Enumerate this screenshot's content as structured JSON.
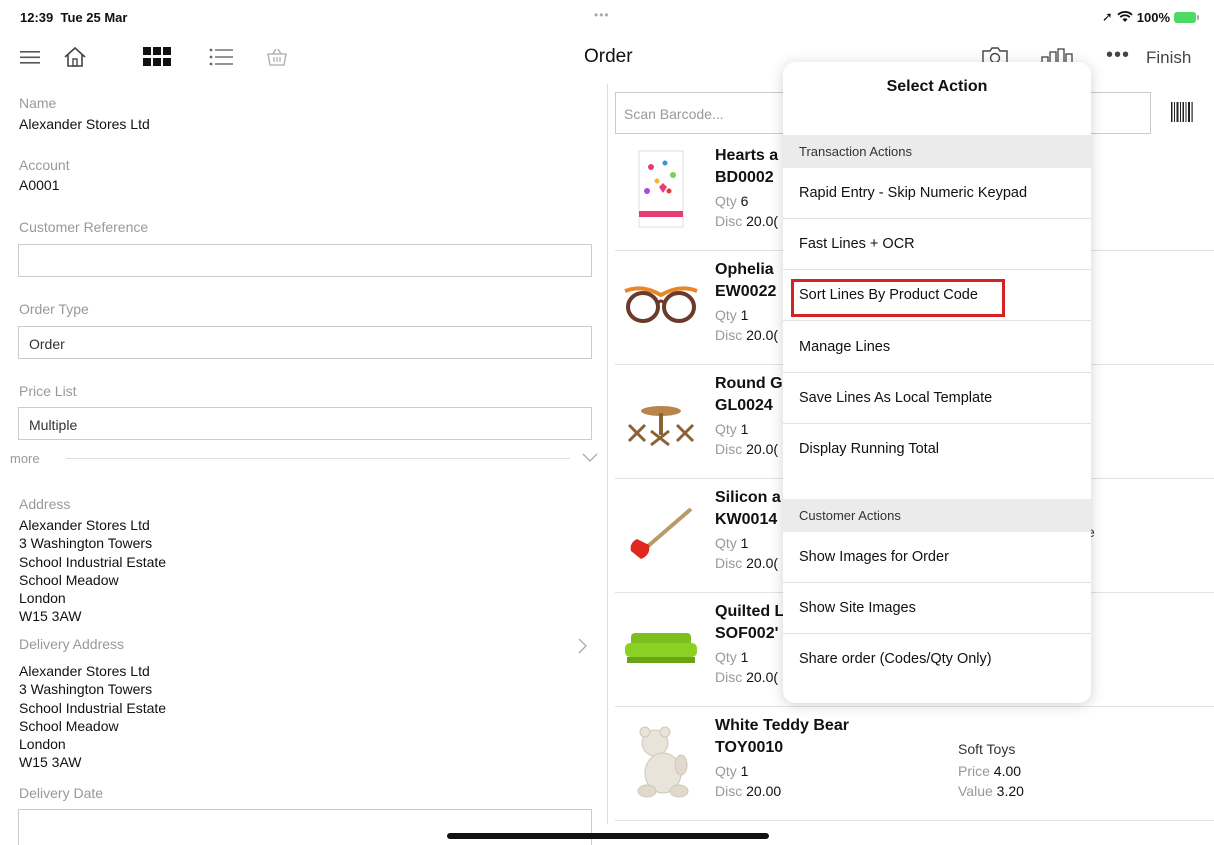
{
  "status_bar": {
    "time": "12:39",
    "date": "Tue 25 Mar",
    "battery": "100%"
  },
  "nav": {
    "title": "Order",
    "more_label": "•••",
    "finish_label": "Finish"
  },
  "customer": {
    "name_label": "Name",
    "name_value": "Alexander Stores Ltd",
    "account_label": "Account",
    "account_value": "A0001",
    "reference_label": "Customer Reference",
    "reference_value": "",
    "order_type_label": "Order Type",
    "order_type_value": "Order",
    "price_list_label": "Price List",
    "price_list_value": "Multiple",
    "more_label": "more",
    "address_label": "Address",
    "address_lines": [
      "Alexander Stores Ltd",
      "3 Washington Towers",
      "School Industrial Estate",
      "School Meadow",
      "London",
      "W15 3AW"
    ],
    "delivery_address_label": "Delivery Address",
    "delivery_address_lines": [
      "Alexander Stores Ltd",
      "3 Washington Towers",
      "School Industrial Estate",
      "School Meadow",
      "London",
      "W15 3AW"
    ],
    "delivery_date_label": "Delivery Date"
  },
  "scan": {
    "placeholder": "Scan Barcode..."
  },
  "products": [
    {
      "name": "Hearts a",
      "code": "BD0002",
      "qty_label": "Qty",
      "qty": "6",
      "disc_label": "Disc",
      "disc": "20.0("
    },
    {
      "name": "Ophelia",
      "code": "EW0022",
      "qty_label": "Qty",
      "qty": "1",
      "disc_label": "Disc",
      "disc": "20.0("
    },
    {
      "name": "Round G",
      "code": "GL0024",
      "qty_label": "Qty",
      "qty": "1",
      "disc_label": "Disc",
      "disc": "20.0("
    },
    {
      "name": "Silicon a",
      "code": "KW0014",
      "qty_label": "Qty",
      "qty": "1",
      "disc_label": "Disc",
      "disc": "20.0("
    },
    {
      "name": "Quilted L",
      "code": "SOF002'",
      "qty_label": "Qty",
      "qty": "1",
      "disc_label": "Disc",
      "disc": "20.0("
    },
    {
      "name": "White Teddy Bear",
      "code": "TOY0010",
      "qty_label": "Qty",
      "qty": "1",
      "disc_label": "Disc",
      "disc": "20.00",
      "category": "Soft Toys",
      "price_label": "Price",
      "price": "4.00",
      "value_label": "Value",
      "value": "3.20"
    }
  ],
  "stray_text": "e",
  "popover": {
    "title": "Select Action",
    "transaction_section": "Transaction Actions",
    "transaction_actions": [
      "Rapid Entry - Skip Numeric Keypad",
      "Fast Lines + OCR",
      "Sort Lines By Product Code",
      "Manage Lines",
      "Save Lines As Local Template",
      "Display Running Total"
    ],
    "customer_section": "Customer Actions",
    "customer_actions": [
      "Show Images for Order",
      "Show Site Images",
      "Share order (Codes/Qty Only)"
    ]
  },
  "colors": {
    "highlight": "#d62121",
    "battery": "#4cd964",
    "section_bg": "#ebebeb"
  }
}
